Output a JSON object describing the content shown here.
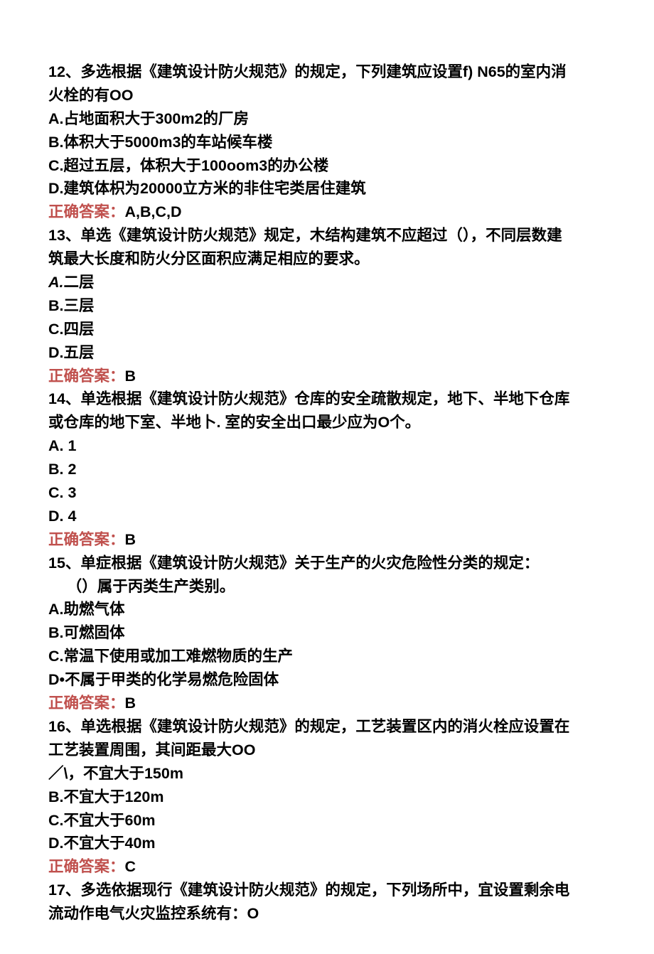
{
  "q12": {
    "stem_a": "12、多选根据《建筑设计防火规范》的规定，下列建筑应设置f)  N65的室内消",
    "stem_b": "火栓的有OO",
    "optA_letter": "A.",
    "optA_text": "占地面积大于300m2的厂房",
    "optB_letter": "B.",
    "optB_text": "体积大于5000m3的车站候车楼",
    "optC_letter": "C.",
    "optC_text": "超过五层，体积大于100oom3的办公楼",
    "optD_letter": "D.",
    "optD_text": "建筑体枳为20000立方米的非住宅类居住建筑",
    "ans_label": "正确答案：",
    "ans_value": "A,B,C,D"
  },
  "q13": {
    "stem_a": "13、单选《建筑设计防火规范》规定，木结构建筑不应超过（），不同层数建",
    "stem_b": "筑最大长度和防火分区面积应满足相应的要求。",
    "optA_letter": "A.",
    "optA_text": "二层",
    "optB_letter": "B.",
    "optB_text": "三层",
    "optC_letter": "C.",
    "optC_text": "四层",
    "optD_letter": "D.",
    "optD_text": "五层",
    "ans_label": "正确答案：",
    "ans_value": "B"
  },
  "q14": {
    "stem_a": "14、单选根据《建筑设计防火规范》仓库的安全疏散规定，地下、半地下仓库",
    "stem_b": "或仓库的地下室、半地卜. 室的安全出口最少应为O个。",
    "optA": "A.   1",
    "optB": "B.   2",
    "optC": "C.   3",
    "optD": "D.   4",
    "ans_label": "正确答案：",
    "ans_value": "B"
  },
  "q15": {
    "stem_a": "15、单症根据《建筑设计防火规范》关于生产的火灾危险性分类的规定：",
    "stem_b": "（）属于丙类生产类别。",
    "optA_letter": "A.",
    "optA_text": "助燃气体",
    "optB_letter": "B.",
    "optB_text": "可燃固体",
    "optC_letter": "C.",
    "optC_text": "常温下使用或加工难燃物质的生产",
    "optD_letter": "D•",
    "optD_text": "不属于甲类的化学易燃危险固体",
    "ans_label": "正确答案：",
    "ans_value": "B"
  },
  "q16": {
    "stem_a": "16、单选根据《建筑设计防火规范》的规定，工艺装置区内的消火栓应设置在",
    "stem_b": "工艺装置周围，其间距最大OO",
    "optA": "／\\，不宜大于150m",
    "optB_letter": "B.",
    "optB_text": "不宜大于120m",
    "optC_letter": "C.",
    "optC_text": "不宜大于60m",
    "optD_letter": "D.",
    "optD_text": "不宜大于40m",
    "ans_label": "正确答案：",
    "ans_value": "C"
  },
  "q17": {
    "stem_a": "17、多选依据现行《建筑设计防火规范》的规定，下列场所中，宜设置剩余电",
    "stem_b": "流动作电气火灾监控系统有：O"
  }
}
